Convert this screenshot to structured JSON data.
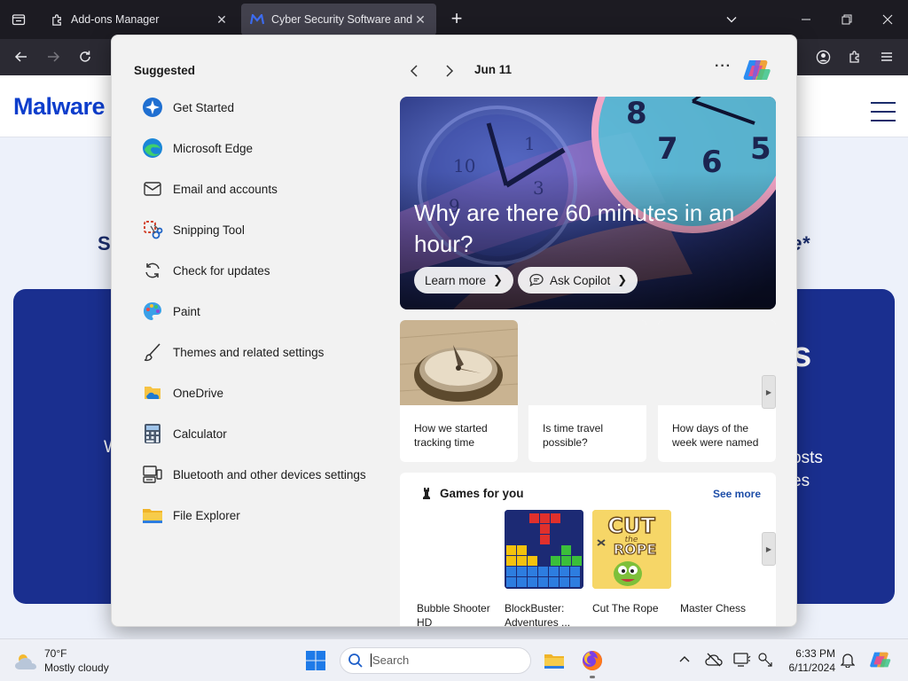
{
  "browser": {
    "tabs": [
      {
        "title": "Add-ons Manager",
        "active": false
      },
      {
        "title": "Cyber Security Software and Anti-Malware | Malwarebytes",
        "active": true
      }
    ]
  },
  "webpage": {
    "logo_text": "Malware",
    "fragment_left": "S",
    "fragment_right": "e*",
    "card_left": "W",
    "card_right_1": "osts",
    "card_right_2": "es",
    "card_big": "s"
  },
  "start_menu": {
    "suggested_title": "Suggested",
    "apps": [
      {
        "label": "Get Started",
        "icon": "get-started-icon"
      },
      {
        "label": "Microsoft Edge",
        "icon": "edge-icon"
      },
      {
        "label": "Email and accounts",
        "icon": "mail-icon"
      },
      {
        "label": "Snipping Tool",
        "icon": "snipping-tool-icon"
      },
      {
        "label": "Check for updates",
        "icon": "refresh-icon"
      },
      {
        "label": "Paint",
        "icon": "paint-icon"
      },
      {
        "label": "Themes and related settings",
        "icon": "brush-icon"
      },
      {
        "label": "OneDrive",
        "icon": "onedrive-icon"
      },
      {
        "label": "Calculator",
        "icon": "calculator-icon"
      },
      {
        "label": "Bluetooth and other devices settings",
        "icon": "devices-icon"
      },
      {
        "label": "File Explorer",
        "icon": "folder-icon"
      }
    ],
    "feed": {
      "date": "Jun 11",
      "more": "···",
      "hero": {
        "headline": "Why are there 60 minutes in an hour?",
        "learn_more": "Learn more",
        "ask_copilot": "Ask Copilot"
      },
      "articles": [
        {
          "caption": "How we started tracking time"
        },
        {
          "caption": "Is time travel possible?"
        },
        {
          "caption": "How days of the week were named"
        }
      ],
      "games": {
        "title": "Games for you",
        "see_more": "See more",
        "items": [
          {
            "name": "Bubble Shooter HD"
          },
          {
            "name": "BlockBuster: Adventures ..."
          },
          {
            "name": "Cut The Rope"
          },
          {
            "name": "Master Chess"
          }
        ],
        "cut_rope_text_1": "CUT",
        "cut_rope_text_2": "the",
        "cut_rope_text_3": "ROPE"
      }
    }
  },
  "taskbar": {
    "weather_temp": "70°F",
    "weather_desc": "Mostly cloudy",
    "search_placeholder": "Search",
    "time": "6:33 PM",
    "date": "6/11/2024"
  }
}
